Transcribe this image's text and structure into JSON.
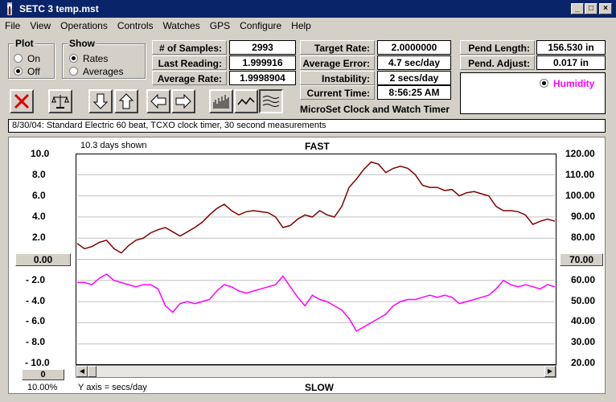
{
  "window": {
    "title": "SETC 3 temp.mst"
  },
  "menu": [
    "File",
    "View",
    "Operations",
    "Controls",
    "Watches",
    "GPS",
    "Configure",
    "Help"
  ],
  "plot_group": {
    "label": "Plot",
    "options": [
      "On",
      "Off"
    ],
    "selected": "Off"
  },
  "show_group": {
    "label": "Show",
    "options": [
      "Rates",
      "Averages"
    ],
    "selected": "Rates"
  },
  "stats": {
    "samples_label": "# of Samples:",
    "samples": "2993",
    "last_reading_label": "Last Reading:",
    "last_reading": "1.999916",
    "avg_rate_label": "Average Rate:",
    "avg_rate": "1.9998904",
    "target_rate_label": "Target Rate:",
    "target_rate": "2.0000000",
    "avg_error_label": "Average Error:",
    "avg_error": "4.7 sec/day",
    "instability_label": "Instability:",
    "instability": "2 secs/day",
    "current_time_label": "Current Time:",
    "current_time": "8:56:25 AM",
    "pend_length_label": "Pend Length:",
    "pend_length": "156.530 in",
    "pend_adjust_label": "Pend. Adjust:",
    "pend_adjust": "0.017 in"
  },
  "humidity_label": "Humidity",
  "app_name": "MicroSet Clock and Watch Timer",
  "note": "8/30/04: Standard Electric 60 beat, TCXO clock timer, 30 second measurements",
  "plot": {
    "days_shown": "10.3 days shown",
    "top_label": "FAST",
    "bottom_label": "SLOW",
    "y_axis_note": "Y axis = secs/day",
    "left_ticks": [
      "10.0",
      "8.0",
      "6.0",
      "4.0",
      "2.0",
      "0.00",
      "- 2.0",
      "- 4.0",
      "- 6.0",
      "- 8.0",
      "- 10.0"
    ],
    "right_ticks": [
      "120.00",
      "110.00",
      "100.00",
      "90.00",
      "80.00",
      "70.00",
      "60.00",
      "50.00",
      "40.00",
      "30.00",
      "20.00"
    ],
    "left_offset_box": "0",
    "zoom_percent": "10.00%"
  },
  "colors": {
    "rate_series": "#800000",
    "humidity_series": "#ff00ff",
    "title_bar": "#0a246a"
  },
  "chart_data": {
    "type": "line",
    "x_label": "",
    "series": [
      {
        "name": "",
        "axis": "left",
        "unit": "secs/day",
        "values": [
          1.5,
          1.0,
          1.2,
          1.6,
          1.8,
          1.0,
          0.6,
          1.3,
          1.8,
          2.0,
          2.5,
          2.8,
          3.0,
          2.6,
          2.2,
          2.6,
          3.0,
          3.5,
          4.2,
          4.8,
          5.2,
          4.6,
          4.2,
          4.5,
          4.6,
          4.5,
          4.4,
          4.0,
          3.0,
          3.2,
          3.8,
          4.2,
          4.0,
          4.6,
          4.2,
          4.0,
          5.0,
          6.8,
          7.6,
          8.5,
          9.2,
          9.0,
          8.2,
          8.6,
          8.8,
          8.6,
          8.0,
          7.0,
          6.8,
          6.8,
          6.5,
          6.6,
          6.0,
          6.3,
          6.4,
          6.2,
          6.0,
          5.0,
          4.6,
          4.6,
          4.5,
          4.2,
          3.3,
          3.6,
          3.8,
          3.6
        ]
      },
      {
        "name": "Humidity",
        "axis": "right",
        "unit": "%",
        "values": [
          59,
          59,
          58,
          61,
          63,
          60,
          59,
          58,
          57,
          58,
          58,
          56,
          48,
          45,
          49,
          50,
          49,
          50,
          51,
          55,
          58,
          57,
          55,
          54,
          55,
          56,
          57,
          58,
          62,
          57,
          52,
          48,
          53,
          51,
          50,
          48,
          46,
          42,
          36,
          38,
          40,
          42,
          44,
          48,
          50,
          51,
          51,
          52,
          53,
          52,
          53,
          52,
          49,
          50,
          51,
          52,
          53,
          56,
          60,
          58,
          57,
          58,
          57,
          56,
          58,
          57
        ]
      }
    ],
    "left_axis": {
      "min": -10,
      "max": 10,
      "label": "secs/day"
    },
    "right_axis": {
      "min": 20,
      "max": 120
    },
    "grid": true
  }
}
